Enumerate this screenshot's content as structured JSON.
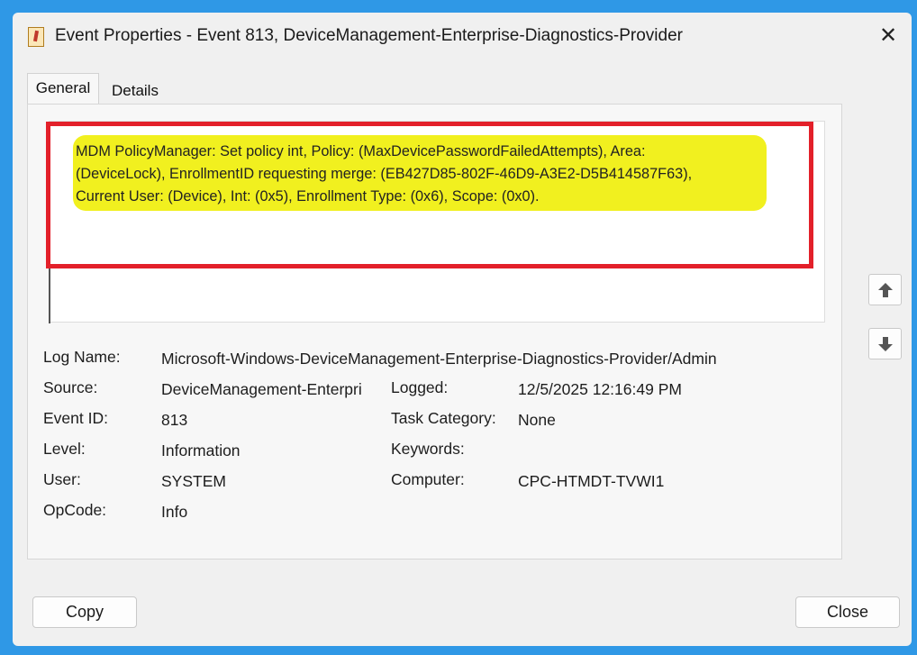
{
  "window": {
    "title": "Event Properties - Event 813, DeviceManagement-Enterprise-Diagnostics-Provider"
  },
  "tabs": [
    {
      "label": "General",
      "selected": true
    },
    {
      "label": "Details",
      "selected": false
    }
  ],
  "description": {
    "lines": [
      "MDM PolicyManager: Set policy int, Policy: (MaxDevicePasswordFailedAttempts), Area:",
      "(DeviceLock), EnrollmentID requesting merge: (EB427D85-802F-46D9-A3E2-D5B414587F63),",
      "Current User: (Device), Int: (0x5), Enrollment Type: (0x6), Scope: (0x0)."
    ],
    "highlight_color": "#f1f01f",
    "annotation_color": "#e3202a"
  },
  "fields": {
    "log_name": {
      "label": "Log Name:",
      "value": "Microsoft-Windows-DeviceManagement-Enterprise-Diagnostics-Provider/Admin"
    },
    "source": {
      "label": "Source:",
      "value": "DeviceManagement-Enterpri"
    },
    "logged": {
      "label": "Logged:",
      "value": "12/5/2025 12:16:49 PM"
    },
    "event_id": {
      "label": "Event ID:",
      "value": "813"
    },
    "task_category": {
      "label": "Task Category:",
      "value": "None"
    },
    "level": {
      "label": "Level:",
      "value": "Information"
    },
    "keywords": {
      "label": "Keywords:",
      "value": ""
    },
    "user": {
      "label": "User:",
      "value": "SYSTEM"
    },
    "computer": {
      "label": "Computer:",
      "value": "CPC-HTMDT-TVWI1"
    },
    "opcode": {
      "label": "OpCode:",
      "value": "Info"
    }
  },
  "buttons": {
    "copy": "Copy",
    "close": "Close"
  },
  "icons": {
    "title": "event-viewer-icon",
    "close": "close-icon",
    "up": "arrow-up-icon",
    "down": "arrow-down-icon"
  },
  "colors": {
    "background": "#2f98e6",
    "window": "#f0f0f0"
  }
}
